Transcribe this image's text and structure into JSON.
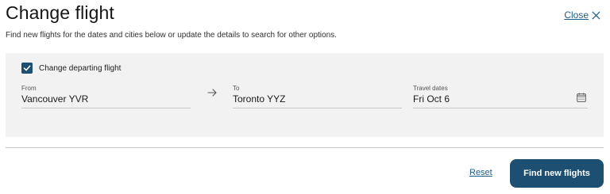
{
  "header": {
    "title": "Change flight",
    "close_label": "Close",
    "subtitle": "Find new flights for the dates and cities below or update the details to search for other options."
  },
  "form": {
    "change_departing": {
      "label": "Change departing flight",
      "checked": true
    },
    "from": {
      "label": "From",
      "value": "Vancouver YVR"
    },
    "to": {
      "label": "To",
      "value": "Toronto YYZ"
    },
    "dates": {
      "label": "Travel dates",
      "value": "Fri Oct 6"
    },
    "icons": {
      "swap": "arrow-right-icon",
      "calendar": "calendar-icon",
      "close": "close-icon",
      "check": "checkmark-icon"
    }
  },
  "actions": {
    "reset_label": "Reset",
    "find_label": "Find new flights"
  },
  "colors": {
    "accent": "#1d4f73",
    "link": "#1a5e8e",
    "panel": "#f2f2f2"
  }
}
